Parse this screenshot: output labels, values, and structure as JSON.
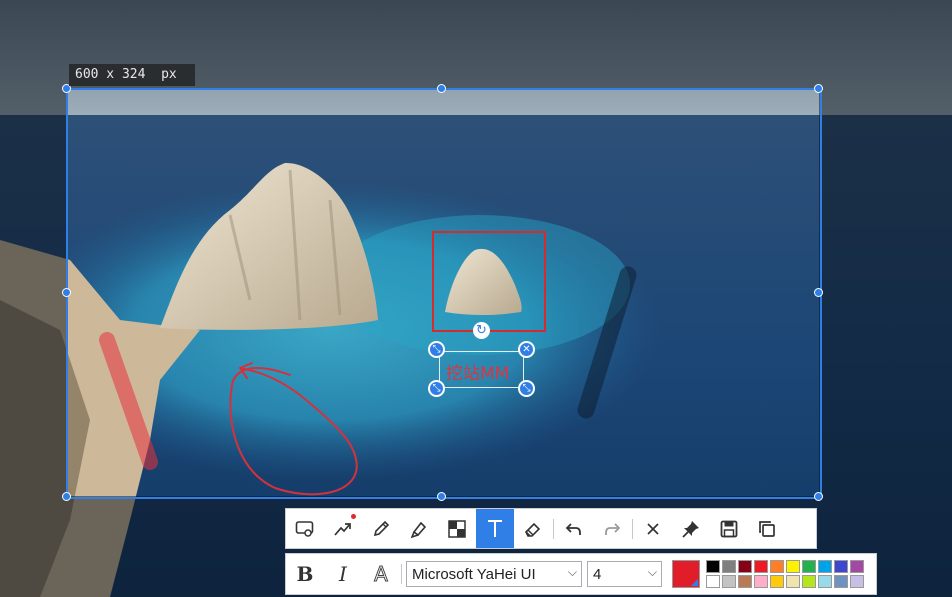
{
  "capture": {
    "size_label": "600 x 324  px"
  },
  "annotations": {
    "text_content": "挖站MM",
    "rotate_glyph": "↻",
    "close_glyph": "✕",
    "resize_glyph": "⤡"
  },
  "toolbar": {
    "tools": [
      {
        "name": "rectangle-tool",
        "icon": "rectangle-icon"
      },
      {
        "name": "arrow-tool",
        "icon": "arrow-icon",
        "dot": true
      },
      {
        "name": "pencil-tool",
        "icon": "pencil-icon"
      },
      {
        "name": "marker-tool",
        "icon": "marker-icon"
      },
      {
        "name": "mosaic-tool",
        "icon": "mosaic-icon"
      },
      {
        "name": "text-tool",
        "icon": "text-icon",
        "active": true,
        "glyph": "T"
      },
      {
        "name": "eraser-tool",
        "icon": "eraser-icon"
      },
      {
        "name": "undo",
        "icon": "undo-icon"
      },
      {
        "name": "redo",
        "icon": "redo-icon"
      },
      {
        "name": "cancel",
        "icon": "close-icon"
      },
      {
        "name": "pin",
        "icon": "pin-icon"
      },
      {
        "name": "save",
        "icon": "save-icon"
      },
      {
        "name": "copy",
        "icon": "copy-icon"
      }
    ]
  },
  "text_toolbar": {
    "bold_label": "B",
    "italic_label": "I",
    "outline_label": "A",
    "font_family": "Microsoft YaHei UI",
    "font_size": "4",
    "current_color": "#e11d2a",
    "palette": [
      "#000000",
      "#7f7f7f",
      "#880015",
      "#ed1c24",
      "#ff7f27",
      "#fff200",
      "#22b14c",
      "#00a2e8",
      "#3f48cc",
      "#a349a4",
      "#ffffff",
      "#c3c3c3",
      "#b97a57",
      "#ffaec9",
      "#ffc90e",
      "#efe4b0",
      "#b5e61d",
      "#99d9ea",
      "#7092be",
      "#c8bfe7"
    ]
  }
}
